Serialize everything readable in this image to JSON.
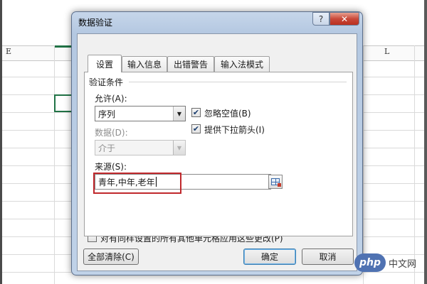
{
  "sheet": {
    "col_e": "E",
    "col_l": "L"
  },
  "dialog": {
    "title": "数据验证",
    "help": "?",
    "close": "✕",
    "tabs": [
      {
        "label": "设置",
        "active": true
      },
      {
        "label": "输入信息",
        "active": false
      },
      {
        "label": "出错警告",
        "active": false
      },
      {
        "label": "输入法模式",
        "active": false
      }
    ],
    "criteria_label": "验证条件",
    "allow": {
      "label": "允许(A):",
      "value": "序列"
    },
    "data": {
      "label": "数据(D):",
      "value": "介于"
    },
    "ignore_blank": {
      "label": "忽略空值(B)",
      "checked": true
    },
    "in_cell_dropdown": {
      "label": "提供下拉箭头(I)",
      "checked": true
    },
    "source": {
      "label": "来源(S):",
      "value": "青年,中年,老年"
    },
    "apply_all": {
      "label": "对有同样设置的所有其他单元格应用这些更改(P)",
      "checked": false
    },
    "buttons": {
      "clear_all": "全部清除(C)",
      "ok": "确定",
      "cancel": "取消"
    },
    "check_mark": "✔",
    "dropdown_arrow": "▼"
  },
  "watermark": {
    "logo": "php",
    "text": "中文网"
  },
  "colors": {
    "highlight": "#c0282c",
    "title_bar": "#b4c8e1",
    "selection": "#217346"
  }
}
